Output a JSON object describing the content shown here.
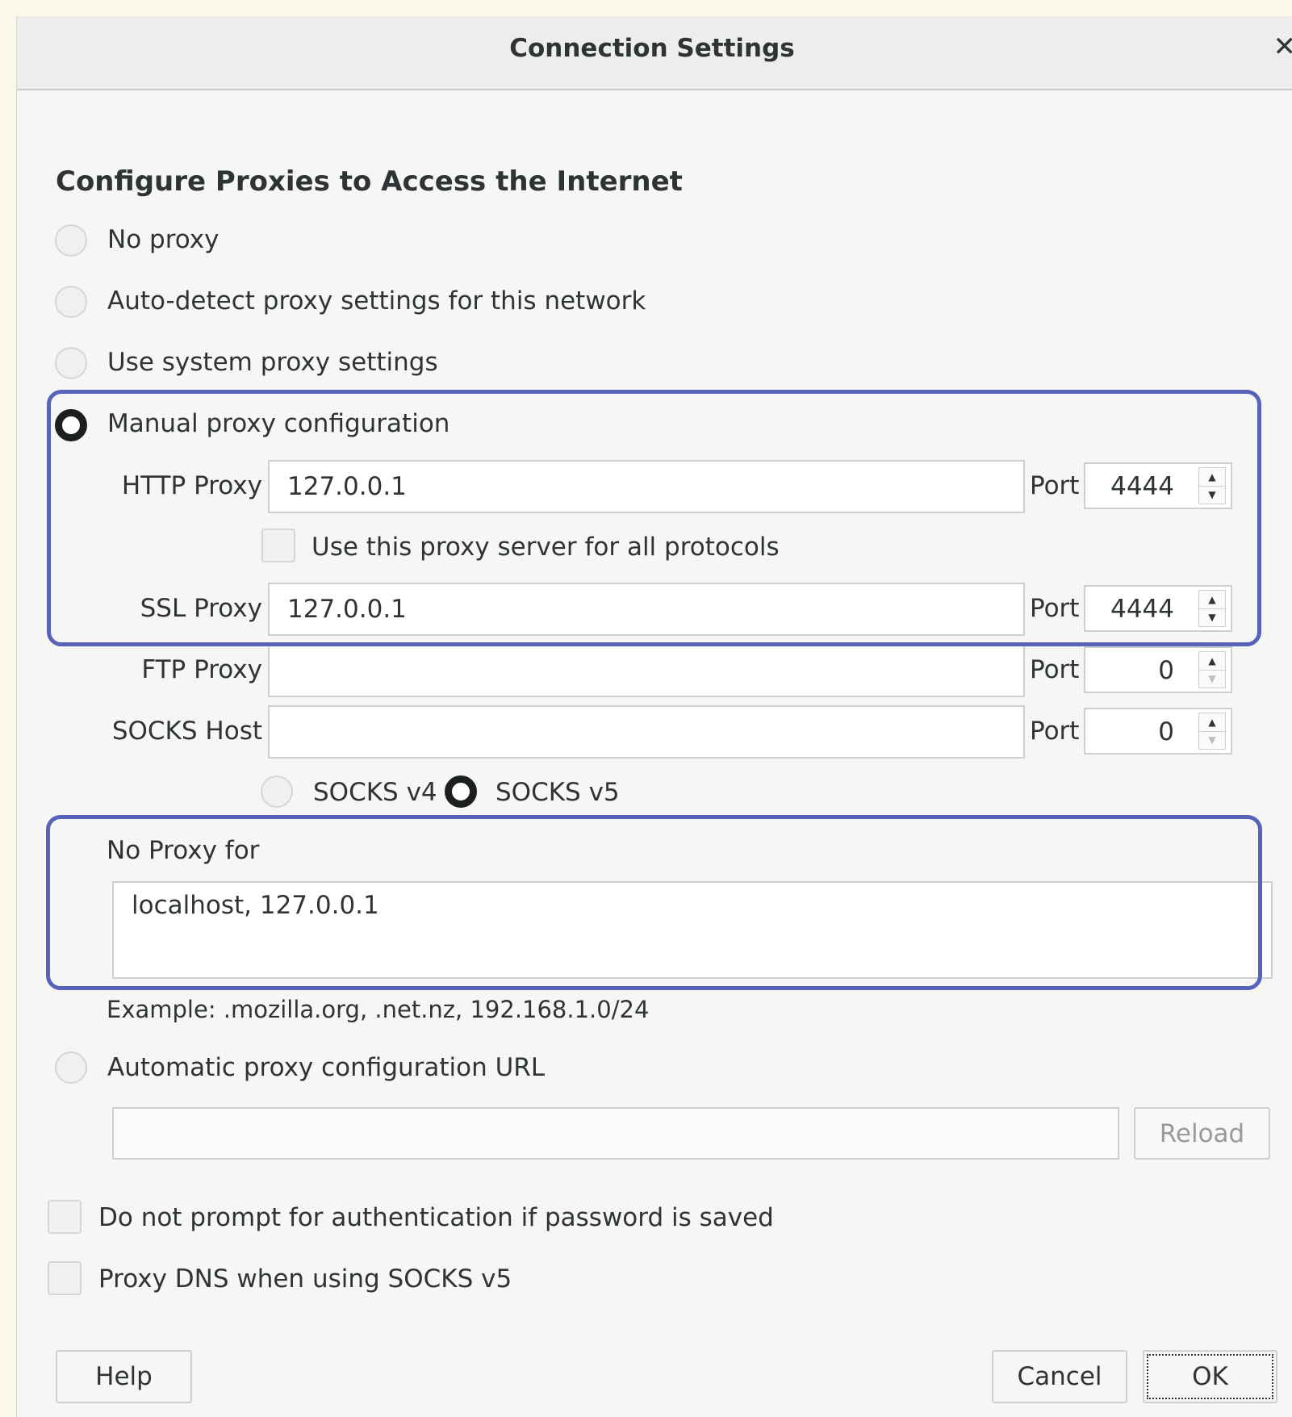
{
  "window": {
    "title": "Connection Settings",
    "close_glyph": "✕"
  },
  "heading": "Configure Proxies to Access the Internet",
  "proxy_modes": {
    "no_proxy": "No proxy",
    "auto_detect": "Auto-detect proxy settings for this network",
    "system": "Use system proxy settings",
    "manual": "Manual proxy configuration",
    "auto_url": "Automatic proxy configuration URL",
    "selected": "manual"
  },
  "manual": {
    "http": {
      "label": "HTTP Proxy",
      "value": "127.0.0.1",
      "port_label": "Port",
      "port": "4444"
    },
    "use_for_all": "Use this proxy server for all protocols",
    "ssl": {
      "label": "SSL Proxy",
      "value": "127.0.0.1",
      "port_label": "Port",
      "port": "4444"
    },
    "ftp": {
      "label": "FTP Proxy",
      "value": "",
      "port_label": "Port",
      "port": "0"
    },
    "socks": {
      "label": "SOCKS Host",
      "value": "",
      "port_label": "Port",
      "port": "0"
    },
    "socks_v4": "SOCKS v4",
    "socks_v5": "SOCKS v5",
    "socks_selected": "v5"
  },
  "no_proxy_for": {
    "label": "No Proxy for",
    "value": "localhost, 127.0.0.1",
    "example": "Example: .mozilla.org, .net.nz, 192.168.1.0/24"
  },
  "auto_url": {
    "value": "",
    "reload_label": "Reload"
  },
  "options": {
    "no_auth_prompt": "Do not prompt for authentication if password is saved",
    "proxy_dns": "Proxy DNS when using SOCKS v5"
  },
  "buttons": {
    "help": "Help",
    "cancel": "Cancel",
    "ok": "OK"
  },
  "colors": {
    "highlight": "#5663b8",
    "page_background": "#fdf8ec"
  },
  "icons": {
    "spin_up": "▲",
    "spin_down": "▼"
  }
}
